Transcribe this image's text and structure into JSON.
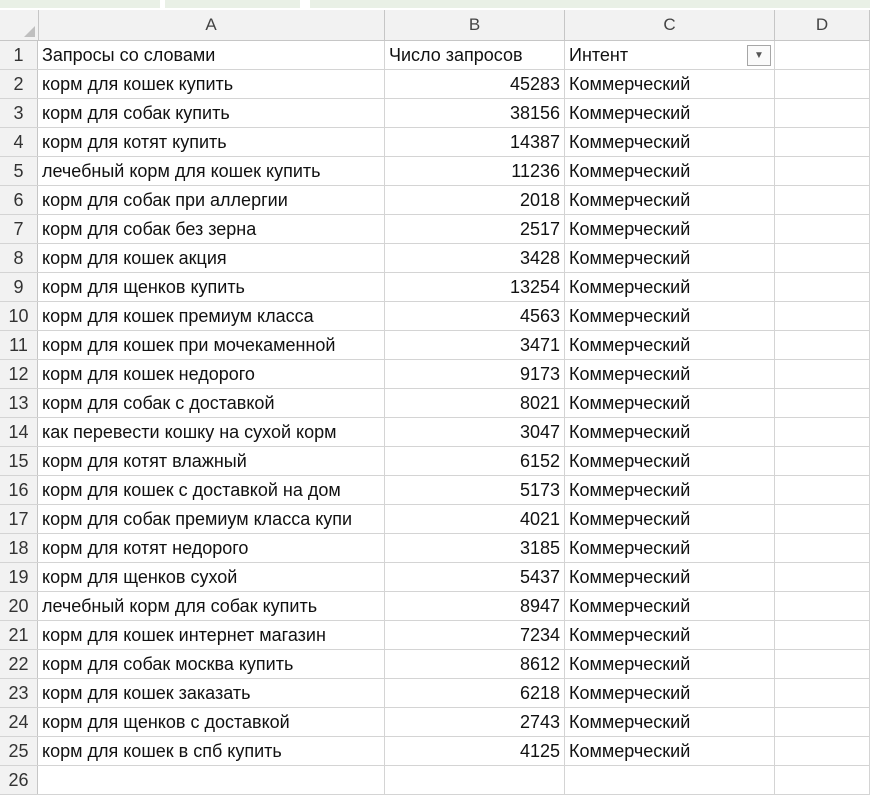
{
  "columns": [
    "A",
    "B",
    "C",
    "D"
  ],
  "header_row": {
    "number": "1",
    "a": "Запросы со словами",
    "b": "Число запросов",
    "c": "Интент"
  },
  "rows": [
    {
      "n": "2",
      "a": "корм для кошек купить",
      "b": "45283",
      "c": "Коммерческий"
    },
    {
      "n": "3",
      "a": "корм для собак купить",
      "b": "38156",
      "c": "Коммерческий"
    },
    {
      "n": "4",
      "a": "корм для котят купить",
      "b": "14387",
      "c": "Коммерческий"
    },
    {
      "n": "5",
      "a": "лечебный корм для кошек купить",
      "b": "11236",
      "c": "Коммерческий"
    },
    {
      "n": "6",
      "a": "корм для собак при аллергии",
      "b": "2018",
      "c": "Коммерческий"
    },
    {
      "n": "7",
      "a": "корм для собак без зерна",
      "b": "2517",
      "c": "Коммерческий"
    },
    {
      "n": "8",
      "a": "корм для кошек акция",
      "b": "3428",
      "c": "Коммерческий"
    },
    {
      "n": "9",
      "a": "корм для щенков купить",
      "b": "13254",
      "c": "Коммерческий"
    },
    {
      "n": "10",
      "a": "корм для кошек премиум класса",
      "b": "4563",
      "c": "Коммерческий"
    },
    {
      "n": "11",
      "a": "корм для кошек при мочекаменной",
      "b": "3471",
      "c": "Коммерческий"
    },
    {
      "n": "12",
      "a": "корм для кошек недорого",
      "b": "9173",
      "c": "Коммерческий"
    },
    {
      "n": "13",
      "a": "корм для собак с доставкой",
      "b": "8021",
      "c": "Коммерческий"
    },
    {
      "n": "14",
      "a": "как перевести кошку на сухой корм",
      "b": "3047",
      "c": "Коммерческий"
    },
    {
      "n": "15",
      "a": "корм для котят влажный",
      "b": "6152",
      "c": "Коммерческий"
    },
    {
      "n": "16",
      "a": "корм для кошек с доставкой на дом",
      "b": "5173",
      "c": "Коммерческий"
    },
    {
      "n": "17",
      "a": "корм для собак премиум класса купи",
      "b": "4021",
      "c": "Коммерческий"
    },
    {
      "n": "18",
      "a": "корм для котят недорого",
      "b": "3185",
      "c": "Коммерческий"
    },
    {
      "n": "19",
      "a": "корм для щенков сухой",
      "b": "5437",
      "c": "Коммерческий"
    },
    {
      "n": "20",
      "a": "лечебный корм для собак купить",
      "b": "8947",
      "c": "Коммерческий"
    },
    {
      "n": "21",
      "a": "корм для кошек интернет магазин",
      "b": "7234",
      "c": "Коммерческий"
    },
    {
      "n": "22",
      "a": "корм для собак москва купить",
      "b": "8612",
      "c": "Коммерческий"
    },
    {
      "n": "23",
      "a": "корм для кошек заказать",
      "b": "6218",
      "c": "Коммерческий"
    },
    {
      "n": "24",
      "a": "корм для щенков с доставкой",
      "b": "2743",
      "c": "Коммерческий"
    },
    {
      "n": "25",
      "a": "корм для кошек в спб купить",
      "b": "4125",
      "c": "Коммерческий"
    },
    {
      "n": "26",
      "a": "",
      "b": "",
      "c": ""
    }
  ],
  "icons": {
    "filter_dropdown": "chevron-down-icon"
  },
  "colors": {
    "header_bg": "#f2f2f2",
    "grid": "#d4d4d4",
    "top_strip": "#e9f0e6"
  }
}
